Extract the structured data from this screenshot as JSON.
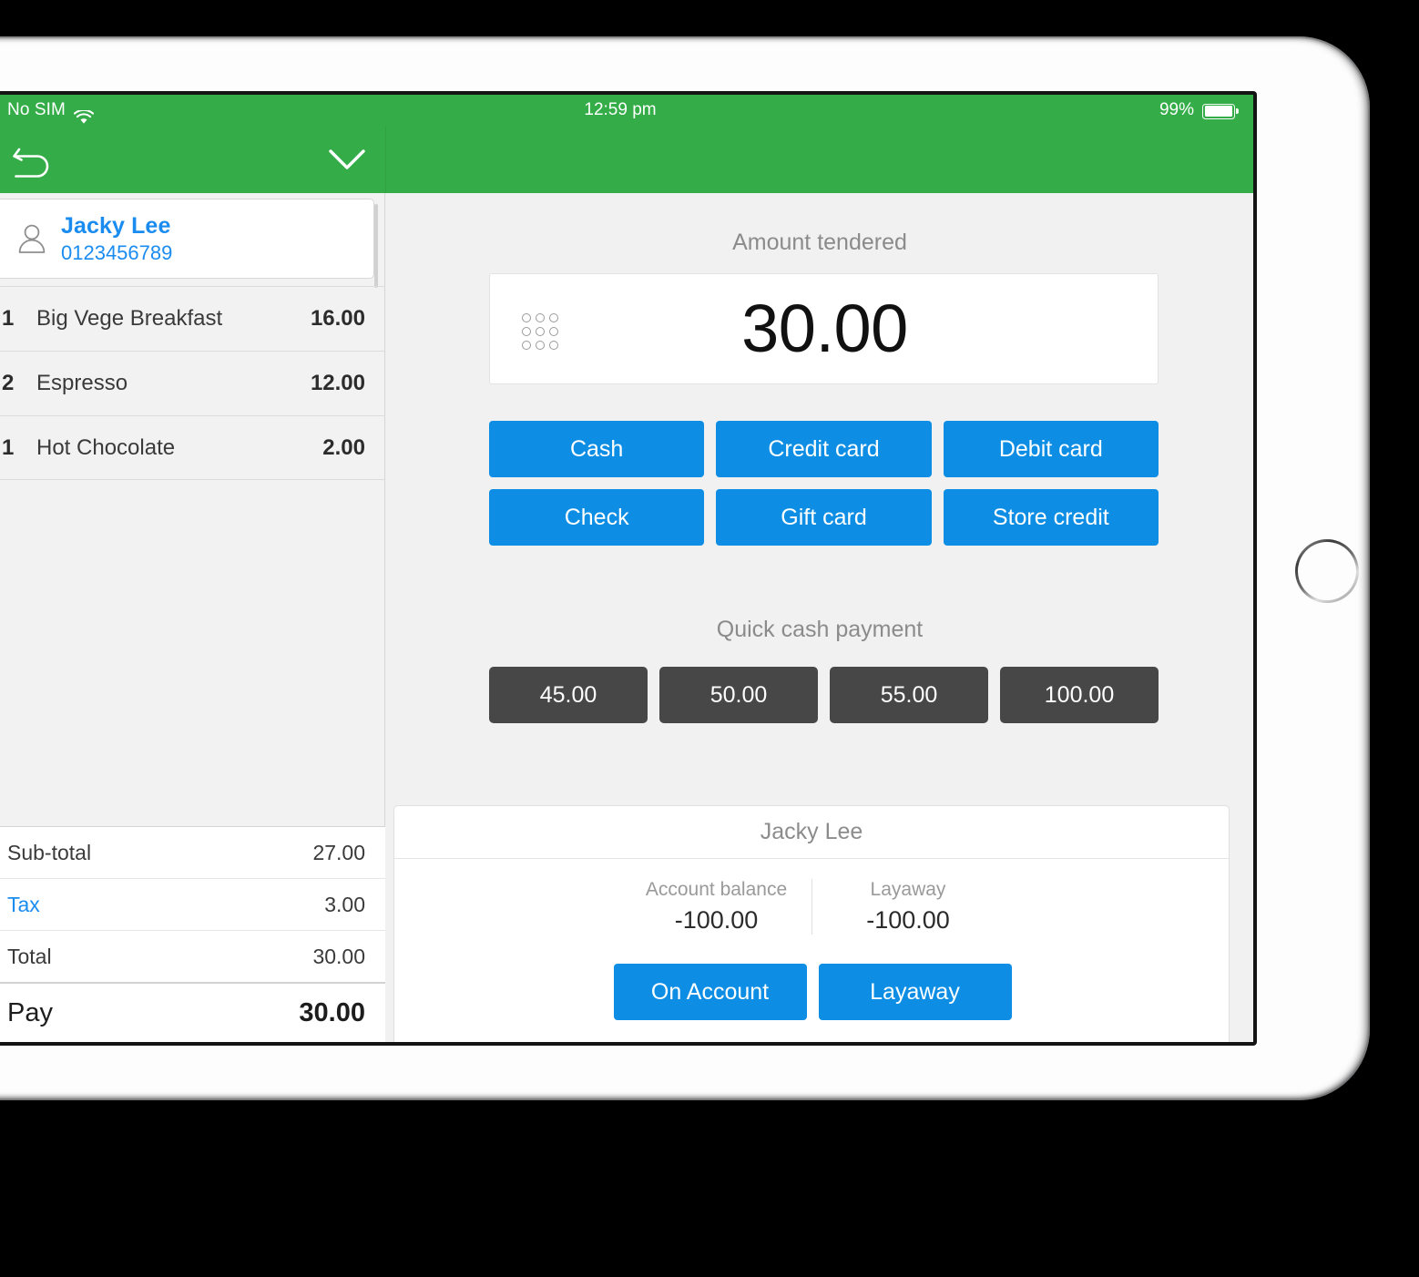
{
  "status_bar": {
    "carrier": "No SIM",
    "wifi_icon": "wifi-icon",
    "time": "12:59 pm",
    "battery_percent": "99%",
    "battery_icon": "battery-full-icon"
  },
  "nav": {
    "back_icon": "undo-arrow-icon",
    "chevron_icon": "chevron-down-icon"
  },
  "sidebar": {
    "customer": {
      "avatar_icon": "person-icon",
      "name": "Jacky Lee",
      "phone": "0123456789"
    },
    "items": [
      {
        "qty": "1",
        "name": "Big Vege Breakfast",
        "price": "16.00"
      },
      {
        "qty": "2",
        "name": "Espresso",
        "price": "12.00"
      },
      {
        "qty": "1",
        "name": "Hot Chocolate",
        "price": "2.00"
      }
    ],
    "totals": [
      {
        "label": "Sub-total",
        "value": "27.00"
      },
      {
        "label": "Tax",
        "value": "3.00"
      },
      {
        "label": "Total",
        "value": "30.00"
      }
    ],
    "pay": {
      "label": "Pay",
      "value": "30.00"
    }
  },
  "main": {
    "tendered_caption": "Amount tendered",
    "tendered_amount": "30.00",
    "keypad_icon": "keypad-grid-icon",
    "payment_methods": [
      "Cash",
      "Credit card",
      "Debit card",
      "Check",
      "Gift card",
      "Store credit"
    ],
    "quick_cash_caption": "Quick cash payment",
    "quick_cash": [
      "45.00",
      "50.00",
      "55.00",
      "100.00"
    ],
    "account_card": {
      "customer_name": "Jacky Lee",
      "balance_label": "Account balance",
      "balance_value": "-100.00",
      "layaway_label": "Layaway",
      "layaway_value": "-100.00",
      "on_account_button": "On Account",
      "layaway_button": "Layaway"
    }
  },
  "colors": {
    "brand_green": "#34ad49",
    "accent_blue": "#0d8ee4",
    "link_blue": "#1a8cf0",
    "quick_cash_gray": "#474747",
    "screen_bg": "#f1f1f1"
  }
}
